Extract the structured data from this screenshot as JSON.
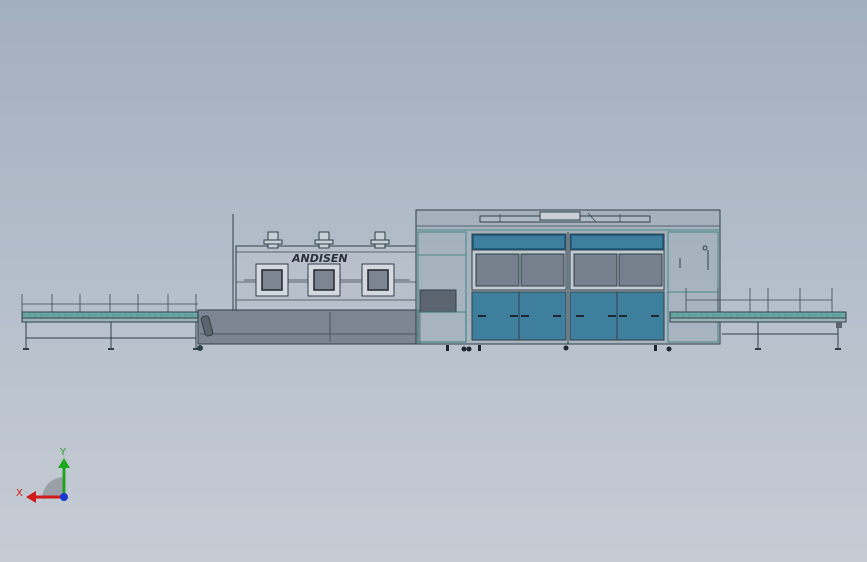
{
  "machine": {
    "brand_text": "ANDISEN"
  },
  "triad": {
    "x_label": "X",
    "y_label": "Y"
  },
  "colors": {
    "background_top": "#a2afbe",
    "background_bottom": "#c6ccd4",
    "tank_blue": "#3f7f9e",
    "tank_blue_dark": "#1f5f86",
    "panel_grey": "#7d8593",
    "conveyor_teal": "#6aa6a3",
    "axis_x": "#d11a1a",
    "axis_y": "#1fa61f",
    "axis_z": "#1a36d1"
  }
}
